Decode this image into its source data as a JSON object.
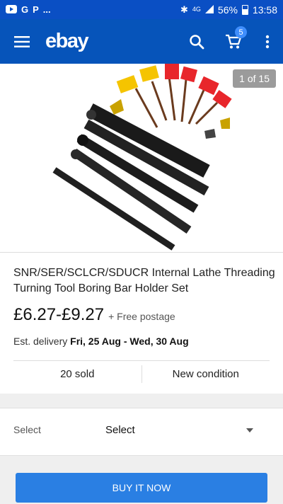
{
  "status_bar": {
    "left_icons": [
      "youtube-icon",
      "g-icon",
      "p-icon"
    ],
    "dots": "...",
    "network": "4G",
    "battery": "56%",
    "time": "13:58"
  },
  "app_bar": {
    "logo": "ebay",
    "cart_count": "5"
  },
  "image": {
    "counter": "1 of 15",
    "handle_colors": [
      "#f5c400",
      "#e8262b"
    ]
  },
  "product": {
    "title": "SNR/SER/SCLCR/SDUCR Internal Lathe Threading Turning Tool Boring Bar Holder Set",
    "price": "£6.27-£9.27",
    "postage": "+ Free postage",
    "delivery_label": "Est. delivery",
    "delivery_dates": "Fri, 25 Aug - Wed, 30 Aug",
    "sold": "20 sold",
    "condition": "New condition"
  },
  "variation": {
    "label": "Select",
    "value": "Select"
  },
  "buy_button": {
    "label": "BUY IT NOW"
  }
}
